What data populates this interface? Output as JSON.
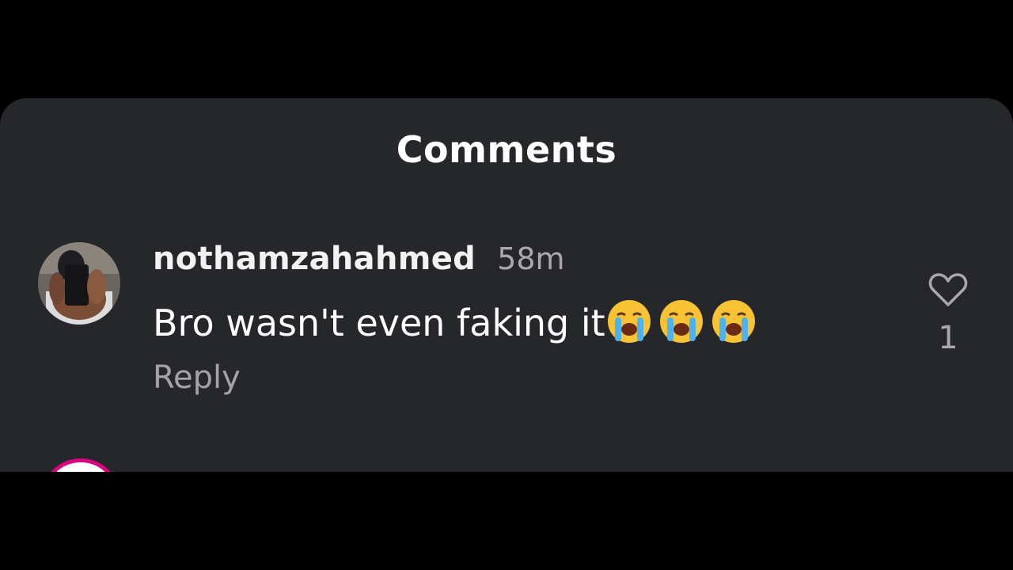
{
  "sheet": {
    "title": "Comments"
  },
  "comment": {
    "username": "nothamzahahmed",
    "timestamp": "58m",
    "text": "Bro wasn't even faking it",
    "emojis": [
      "loudly-crying-face",
      "loudly-crying-face",
      "loudly-crying-face"
    ],
    "reply_label": "Reply",
    "like_icon": "heart-outline-icon",
    "like_count": "1"
  },
  "colors": {
    "background": "#000000",
    "sheet": "#26272b",
    "primary_text": "#ffffff",
    "secondary_text": "#a9a9ad",
    "next_avatar_ring": "#d6087e"
  }
}
